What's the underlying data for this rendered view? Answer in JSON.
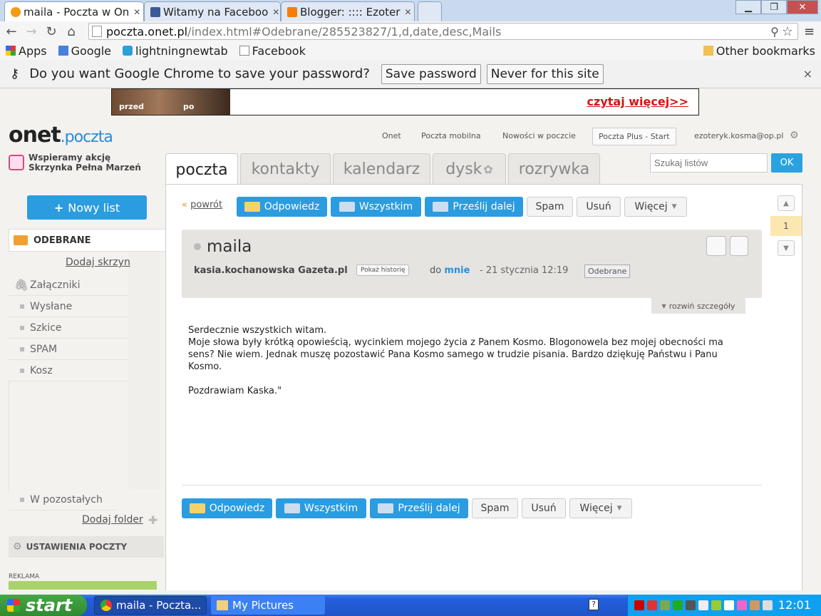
{
  "browser": {
    "tabs": [
      {
        "title": "maila - Poczta w On",
        "icon": "onet-favicon"
      },
      {
        "title": "Witamy na Faceboo",
        "icon": "facebook-favicon"
      },
      {
        "title": "Blogger: :::: Ezoter",
        "icon": "blogger-favicon"
      }
    ],
    "window_buttons": {
      "minimize": "▁",
      "maximize": "❐",
      "close": "✕"
    },
    "nav": {
      "back": "←",
      "forward": "→",
      "reload": "↻",
      "home": "⌂"
    },
    "url_host": "poczta.onet.pl",
    "url_path": "/index.html#Odebrane/285523827/1,d,date,desc,Mails",
    "bookmarks": [
      "Apps",
      "Google",
      "lightningnewtab",
      "Facebook"
    ],
    "other_bookmarks": "Other bookmarks",
    "password_bar": {
      "message": "Do you want Google Chrome to save your password?",
      "save": "Save password",
      "never": "Never for this site",
      "close": "×"
    }
  },
  "ad": {
    "before": "przed",
    "after": "po",
    "more": "czytaj więcej>>"
  },
  "header": {
    "logo_onet": "onet",
    "logo_poczta": ".poczta",
    "promo_line1": "Wspieramy akcję",
    "promo_line2": "Skrzynka Pełna Marzeń",
    "links": [
      "Onet",
      "Poczta mobilna",
      "Nowości w poczcie"
    ],
    "plus_button": "Poczta Plus - Start",
    "user_email": "ezoteryk.kosma@op.pl",
    "search_placeholder": "Szukaj listów",
    "search_ok": "OK"
  },
  "main_tabs": [
    "poczta",
    "kontakty",
    "kalendarz",
    "dysk",
    "rozrywka"
  ],
  "sidebar": {
    "new_mail": "Nowy list",
    "inbox": "ODEBRANE",
    "add_box": "Dodaj skrzyn",
    "folders": [
      "Załączniki",
      "Wysłane",
      "Szkice",
      "SPAM",
      "Kosz"
    ],
    "other_folders": "W pozostałych",
    "add_folder": "Dodaj folder",
    "settings": "USTAWIENIA POCZTY",
    "ad_label": "REKLAMA"
  },
  "actions": {
    "back": "powrót",
    "reply": "Odpowiedz",
    "reply_all": "Wszystkim",
    "forward": "Prześlij dalej",
    "spam": "Spam",
    "delete": "Usuń",
    "more": "Więcej"
  },
  "message": {
    "subject": "maila",
    "sender": "kasia.kochanowska Gazeta.pl",
    "history": "Pokaż historię",
    "to_prefix": "do",
    "to": "mnie",
    "date": "- 21 stycznia 12:19",
    "label": "Odebrane",
    "expand": "rozwiń szczegóły",
    "body": "Serdecznie wszystkich witam.\nMoje słowa były krótką opowieścią, wycinkiem mojego życia z Panem Kosmo. Blogonowela bez mojej obecności ma sens? Nie wiem. Jednak muszę pozostawić Pana Kosmo samego w trudzie pisania. Bardzo dziękuję Państwu i Panu Kosmo.\n\n  Pozdrawiam Kaska.\"",
    "page": "1"
  },
  "taskbar": {
    "start": "start",
    "tasks": [
      "maila - Poczta...",
      "My Pictures"
    ],
    "clock": "12:01"
  }
}
